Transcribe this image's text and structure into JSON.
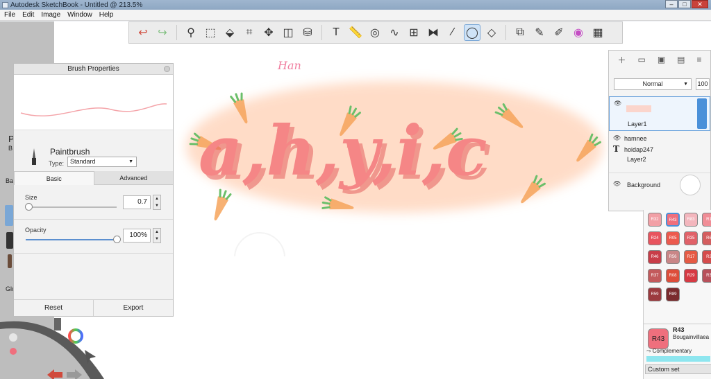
{
  "window": {
    "title": "Autodesk SketchBook - Untitled @ 213.5%",
    "min": "–",
    "max": "□",
    "close": "✕"
  },
  "menu": [
    "File",
    "Edit",
    "Image",
    "Window",
    "Help"
  ],
  "toolbar": {
    "tools": [
      "undo-icon",
      "redo-icon",
      "zoom-icon",
      "select-icon",
      "lasso-icon",
      "crop-icon",
      "transform-icon",
      "distort-icon",
      "fill-icon",
      "text-icon",
      "ruler-icon",
      "ellipse-guide-icon",
      "french-curve-icon",
      "perspective-icon",
      "symmetry-icon",
      "steady-stroke-icon",
      "predictive-stroke-icon",
      "shape-icon",
      "copy-icon",
      "brush-library-icon",
      "copic-library-icon",
      "color-wheel-icon",
      "palette-icon"
    ],
    "active": "predictive-stroke-icon"
  },
  "artwork": {
    "text": "a,h,y,i,c",
    "signature": "Han",
    "colors": {
      "letters": "#f07b7b",
      "letters_shadow": "#e55f5f",
      "background_blob": "#ffd9c2",
      "carrot": "#f6a35a",
      "carrot_leaf": "#6bbf6a"
    }
  },
  "brush_panel": {
    "title": "Brush Properties",
    "brush_name": "Paintbrush",
    "type_label": "Type:",
    "type_value": "Standard",
    "tabs": [
      "Basic",
      "Advanced"
    ],
    "size_label": "Size",
    "size_value": "0.7",
    "size_fraction": 0.03,
    "opacity_label": "Opacity",
    "opacity_value": "100%",
    "opacity_fraction": 1.0,
    "reset": "Reset",
    "export": "Export"
  },
  "left_strip": {
    "letters": [
      "P",
      "B",
      "Ba",
      "Glo"
    ]
  },
  "layer_panel": {
    "blend": "Normal",
    "opacity": "100",
    "layers": [
      {
        "name": "Layer1"
      },
      {
        "name": "hamnee"
      },
      {
        "name": "hoidap247"
      },
      {
        "name": "Layer2"
      },
      {
        "name": "Background"
      }
    ]
  },
  "swatches": {
    "rows": [
      [
        [
          "R32",
          "#f2a0a6"
        ],
        [
          "R43",
          "#ef6f7d"
        ],
        [
          "R83",
          "#f3b6bd"
        ],
        [
          "R1",
          "#f08d96"
        ]
      ],
      [
        [
          "R24",
          "#e8545e"
        ],
        [
          "R05",
          "#ec5a4e"
        ],
        [
          "R35",
          "#e06168"
        ],
        [
          "R6",
          "#d45d5e"
        ]
      ],
      [
        [
          "R46",
          "#c83d48"
        ],
        [
          "R56",
          "#c98687"
        ],
        [
          "R17",
          "#e55a44"
        ],
        [
          "R2",
          "#d54c4c"
        ]
      ],
      [
        [
          "R37",
          "#c35a5c"
        ],
        [
          "R08",
          "#dd4d3a"
        ],
        [
          "R29",
          "#d63a43"
        ],
        [
          "R3",
          "#b8505a"
        ]
      ],
      [
        [
          "R59",
          "#9c3a3e"
        ],
        [
          "R89",
          "#7a2b2e"
        ]
      ]
    ]
  },
  "color_info": {
    "code": "R43",
    "name": "Bougainvillaea",
    "swatch": "#ef6f7d",
    "complementary": "Complementary",
    "complementary_color": "#8ee6ef",
    "custom_set": "Custom set"
  }
}
